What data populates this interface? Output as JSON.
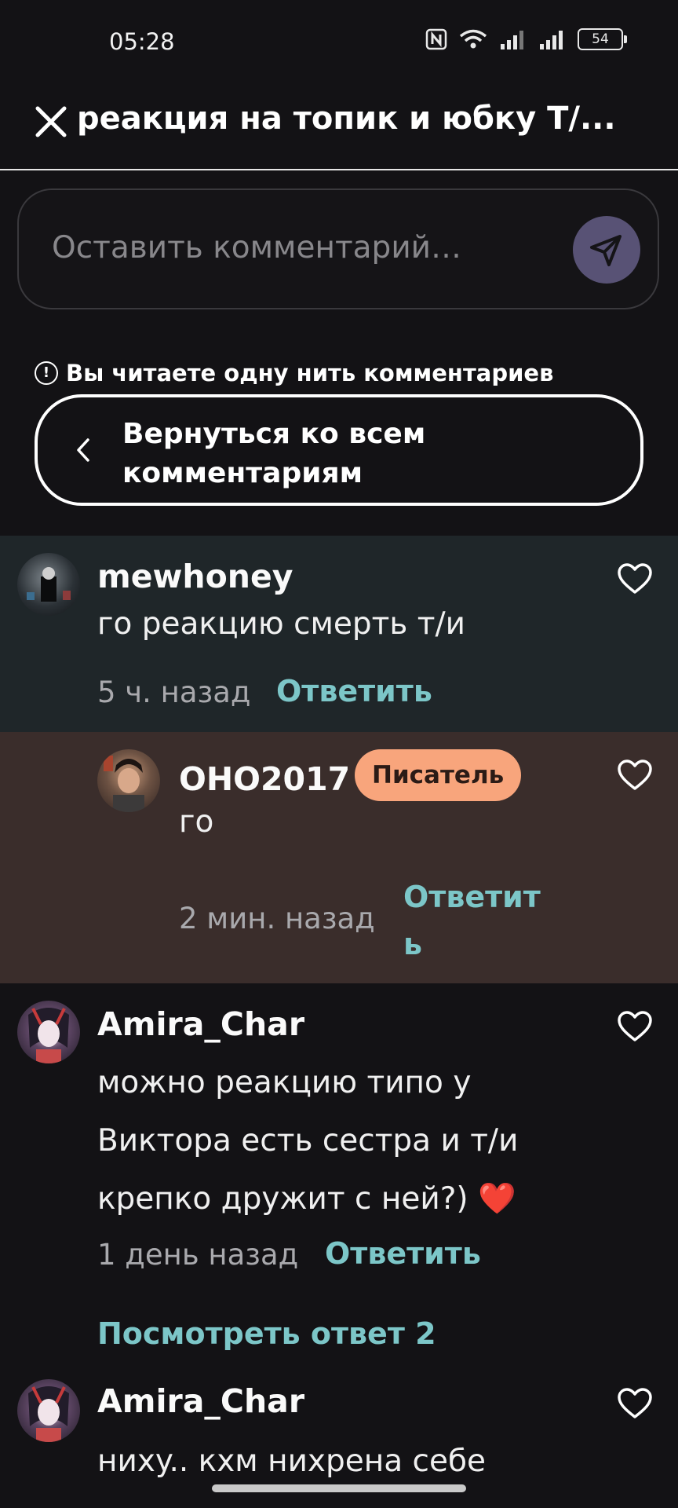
{
  "status_bar": {
    "time": "05:28",
    "battery": "54",
    "icons": [
      "nfc-icon",
      "wifi-icon",
      "signal-icon",
      "signal-icon",
      "battery-icon"
    ]
  },
  "header": {
    "title": "реакция на топик и юбку Т/...",
    "close_icon": "close-icon"
  },
  "composer": {
    "placeholder": "Оставить комментарий…",
    "send_icon": "send-icon",
    "accent": "#585275"
  },
  "thread": {
    "note": "Вы читаете одну нить комментариев",
    "back_label": "Вернуться ко всем комментариям"
  },
  "comments": [
    {
      "username": "mewhoney",
      "text": "го реакцию смерть т/и",
      "time": "5 ч. назад",
      "reply": "Ответить",
      "bg": "#1f2629"
    },
    {
      "username": "OHO2017",
      "badge": "Писатель",
      "text": "го",
      "time": "2 мин. назад",
      "reply_line1": "Ответит",
      "reply_line2": "ь",
      "bg": "#3a2d2b"
    },
    {
      "username": "Amira_Char",
      "text_lines": [
        "можно реакцию типо у",
        "Виктора есть сестра и т/и",
        "крепко дружит с ней?) ❤️"
      ],
      "time": "1 день назад",
      "reply": "Ответить",
      "view_replies": "Посмотреть ответ 2"
    },
    {
      "username": "Amira_Char",
      "text": "нихy.. кхм нихрена себе"
    }
  ],
  "colors": {
    "reply_accent": "#7cc6c8",
    "badge_bg": "#f8a57c"
  }
}
